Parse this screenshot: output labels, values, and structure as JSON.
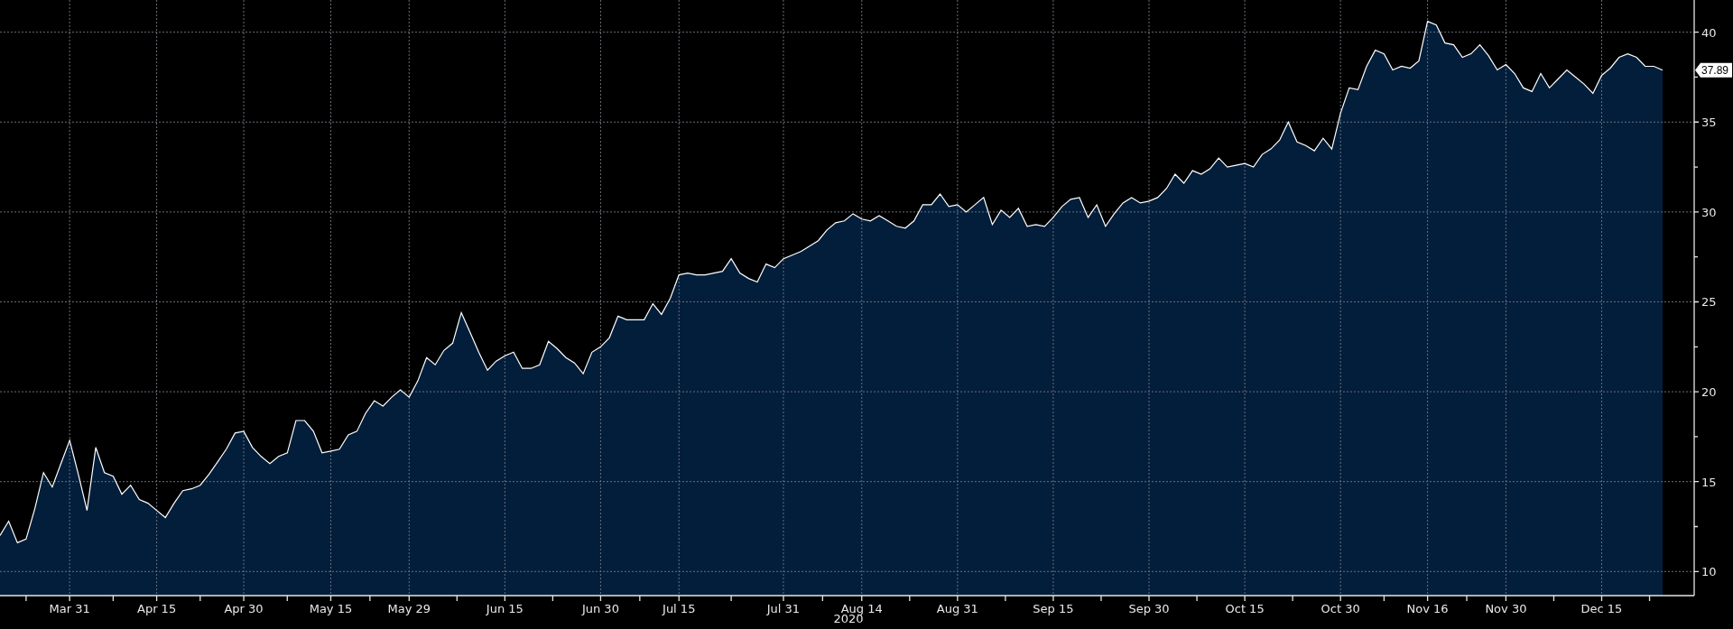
{
  "chart": {
    "chart_data": {
      "type": "area",
      "xlabel": "2020",
      "categories": [
        null,
        null,
        null,
        null,
        null,
        null,
        null,
        null,
        "Mar 31",
        null,
        null,
        null,
        null,
        null,
        null,
        null,
        null,
        null,
        "Apr 15",
        null,
        null,
        null,
        null,
        null,
        null,
        null,
        null,
        null,
        "Apr 30",
        null,
        null,
        null,
        null,
        null,
        null,
        null,
        null,
        null,
        "May 15",
        null,
        null,
        null,
        null,
        null,
        null,
        null,
        null,
        "May 29",
        null,
        null,
        null,
        null,
        null,
        null,
        null,
        null,
        null,
        null,
        "Jun 15",
        null,
        null,
        null,
        null,
        null,
        null,
        null,
        null,
        null,
        null,
        "Jun 30",
        null,
        null,
        null,
        null,
        null,
        null,
        null,
        null,
        "Jul 15",
        null,
        null,
        null,
        null,
        null,
        null,
        null,
        null,
        null,
        null,
        null,
        "Jul 31",
        null,
        null,
        null,
        null,
        null,
        null,
        null,
        null,
        "Aug 14",
        null,
        null,
        null,
        null,
        null,
        null,
        null,
        null,
        null,
        null,
        "Aug 31",
        null,
        null,
        null,
        null,
        null,
        null,
        null,
        null,
        null,
        null,
        "Sep 15",
        null,
        null,
        null,
        null,
        null,
        null,
        null,
        null,
        null,
        null,
        "Sep 30",
        null,
        null,
        null,
        null,
        null,
        null,
        null,
        null,
        null,
        null,
        "Oct 15",
        null,
        null,
        null,
        null,
        null,
        null,
        null,
        null,
        null,
        null,
        "Oct 30",
        null,
        null,
        null,
        null,
        null,
        null,
        null,
        null,
        null,
        "Nov 16",
        null,
        null,
        null,
        null,
        null,
        null,
        null,
        null,
        "Nov 30",
        null,
        null,
        null,
        null,
        null,
        null,
        null,
        null,
        null,
        null,
        "Dec 15",
        null,
        null,
        null,
        null,
        null,
        null,
        null
      ],
      "series": [
        {
          "color": "#ffffff",
          "values": [
            12.0,
            12.8,
            11.6,
            11.8,
            13.5,
            15.5,
            14.7,
            16.0,
            17.3,
            15.4,
            13.4,
            16.9,
            15.5,
            15.3,
            14.3,
            14.8,
            14.0,
            13.8,
            13.4,
            13.0,
            13.8,
            14.5,
            14.6,
            14.8,
            15.4,
            16.1,
            16.8,
            17.7,
            17.8,
            16.9,
            16.4,
            16.0,
            16.4,
            16.6,
            18.4,
            18.4,
            17.8,
            16.6,
            16.7,
            16.8,
            17.6,
            17.8,
            18.8,
            19.5,
            19.2,
            19.7,
            20.1,
            19.7,
            20.6,
            21.9,
            21.5,
            22.3,
            22.7,
            24.4,
            23.3,
            22.2,
            21.2,
            21.7,
            22.0,
            22.2,
            21.3,
            21.3,
            21.5,
            22.8,
            22.4,
            21.9,
            21.6,
            21.0,
            22.2,
            22.5,
            23.0,
            24.2,
            24.0,
            24.0,
            24.0,
            24.9,
            24.3,
            25.2,
            26.5,
            26.6,
            26.5,
            26.5,
            26.6,
            26.7,
            27.4,
            26.6,
            26.3,
            26.1,
            27.1,
            26.9,
            27.4,
            27.6,
            27.8,
            28.1,
            28.4,
            29.0,
            29.4,
            29.5,
            29.9,
            29.6,
            29.5,
            29.8,
            29.5,
            29.2,
            29.1,
            29.5,
            30.4,
            30.4,
            31.0,
            30.3,
            30.4,
            30.0,
            30.4,
            30.8,
            29.3,
            30.1,
            29.7,
            30.2,
            29.2,
            29.3,
            29.2,
            29.7,
            30.3,
            30.7,
            30.8,
            29.7,
            30.4,
            29.2,
            29.9,
            30.5,
            30.8,
            30.5,
            30.6,
            30.8,
            31.3,
            32.1,
            31.6,
            32.3,
            32.1,
            32.4,
            33.0,
            32.5,
            32.6,
            32.7,
            32.5,
            33.2,
            33.5,
            34.0,
            35.0,
            33.9,
            33.7,
            33.4,
            34.1,
            33.5,
            35.5,
            36.9,
            36.8,
            38.1,
            39.0,
            38.8,
            37.9,
            38.1,
            38.0,
            38.4,
            40.6,
            40.4,
            39.4,
            39.3,
            38.6,
            38.8,
            39.3,
            38.7,
            37.9,
            38.2,
            37.7,
            36.9,
            36.7,
            37.7,
            36.9,
            37.4,
            37.9,
            37.5,
            37.1,
            36.6,
            37.6,
            38.0,
            38.6,
            38.8,
            38.6,
            38.1,
            38.1,
            37.89
          ]
        }
      ],
      "ylim": [
        8.66,
        41.79
      ],
      "yticks": [
        10,
        15,
        20,
        25,
        30,
        35,
        40
      ],
      "grid": true
    },
    "last_value_label": "37.89"
  }
}
